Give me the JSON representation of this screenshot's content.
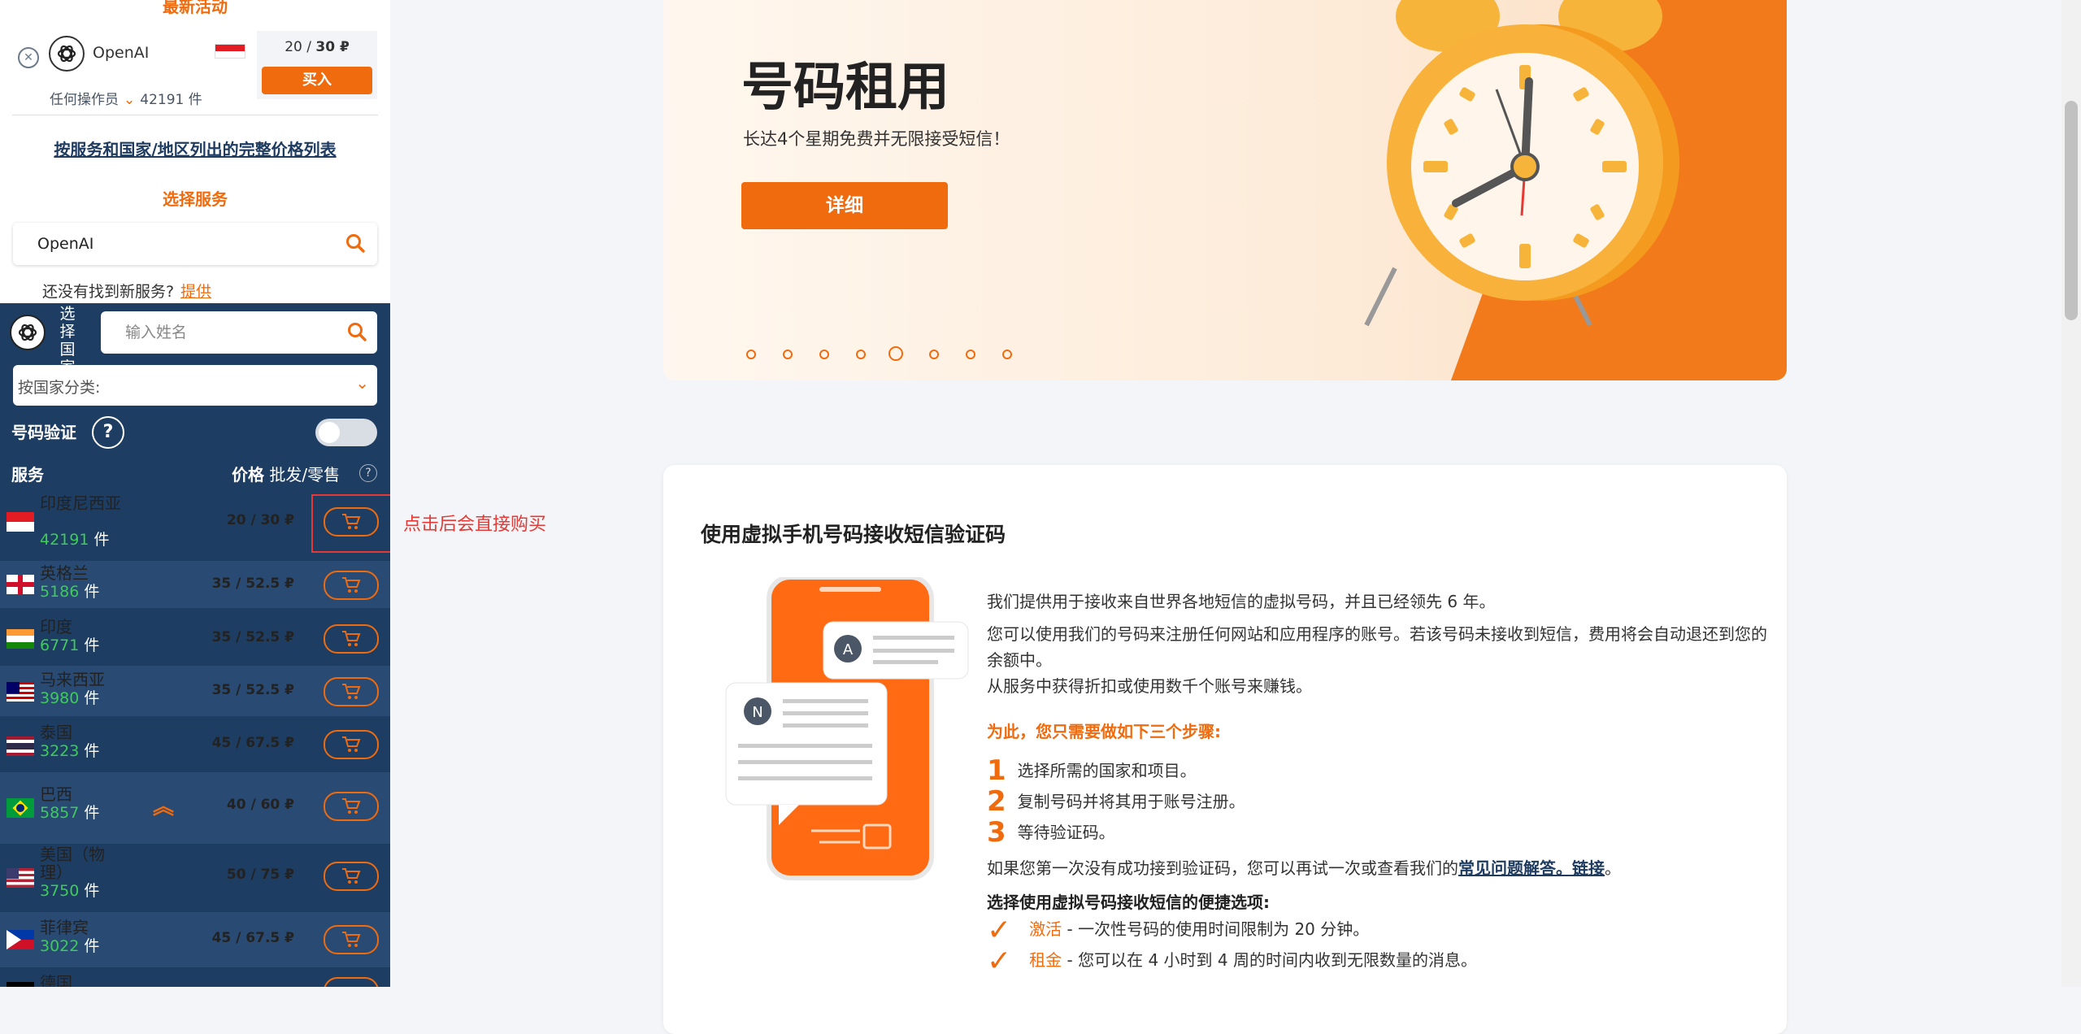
{
  "sidebar": {
    "latest_title": "最新活动",
    "promo": {
      "service": "OpenAI",
      "price_wholesale": "20",
      "price_retail": "30 ₽",
      "price_sep": " / ",
      "buy_label": "买入",
      "operator": "任何操作员",
      "count": "42191 件"
    },
    "full_price_link": "按服务和国家/地区列出的完整价格列表",
    "choose_service": "选择服务",
    "service_value": "OpenAI",
    "not_found_text": "还没有找到新服务?",
    "provide_link": "提供",
    "select_country": "选择国家",
    "name_placeholder": "输入姓名",
    "sort_placeholder": "按国家分类:",
    "verify_label": "号码验证",
    "verify_help": "?",
    "col_service": "服务",
    "col_price": "价格",
    "col_price_sub": "批发/零售",
    "col_help": "?",
    "unit": "件",
    "countries": [
      {
        "name": "印度尼西亚",
        "count": "42191",
        "price": "20 / 30 ₽"
      },
      {
        "name": "英格兰",
        "count": "5186",
        "price": "35 / 52.5 ₽"
      },
      {
        "name": "印度",
        "count": "6771",
        "price": "35 / 52.5 ₽"
      },
      {
        "name": "马来西亚",
        "count": "3980",
        "price": "35 / 52.5 ₽"
      },
      {
        "name": "泰国",
        "count": "3223",
        "price": "45 / 67.5 ₽"
      },
      {
        "name": "巴西",
        "count": "5857",
        "price": "40 / 60 ₽"
      },
      {
        "name": "美国（物理）",
        "count": "3750",
        "price": "50 / 75 ₽"
      },
      {
        "name": "菲律宾",
        "count": "3022",
        "price": "45 / 67.5 ₽"
      },
      {
        "name": "德国",
        "count": "",
        "price": ""
      }
    ],
    "annotation": "点击后会直接购买"
  },
  "banner": {
    "title": "号码租用",
    "subtitle": "长达4个星期免费并无限接受短信！",
    "button": "详细",
    "dots_total": 8,
    "dots_active": 5
  },
  "card": {
    "title": "使用虚拟手机号码接收短信验证码",
    "p1": "我们提供用于接收来自世界各地短信的虚拟号码，并且已经领先 6 年。",
    "p2": "您可以使用我们的号码来注册任何网站和应用程序的账号。若该号码未接收到短信，费用将会自动退还到您的余额中。",
    "p3": "从服务中获得折扣或使用数千个账号来赚钱。",
    "steps_title": "为此，您只需要做如下三个步骤:",
    "steps": [
      {
        "n": "1",
        "text": "选择所需的国家和项目。"
      },
      {
        "n": "2",
        "text": "复制号码并将其用于账号注册。"
      },
      {
        "n": "3",
        "text": "等待验证码。"
      }
    ],
    "retry_text": "如果您第一次没有成功接到验证码，您可以再试一次或查看我们的",
    "faq_link": "常见问题解答。链接",
    "retry_end": "。",
    "options_title": "选择使用虚拟号码接收短信的便捷选项:",
    "options": [
      {
        "key": "激活",
        "text": " - 一次性号码的使用时间限制为 20 分钟。"
      },
      {
        "key": "租金",
        "text": " - 您可以在 4 小时到 4 周的时间内收到无限数量的消息。"
      }
    ],
    "illustration_letters": [
      "A",
      "N"
    ]
  },
  "colors": {
    "accent": "#f06b0e",
    "sidebar_dark": "#1e3d62",
    "count_green": "#3fca5c",
    "annotation_red": "#e53935"
  }
}
